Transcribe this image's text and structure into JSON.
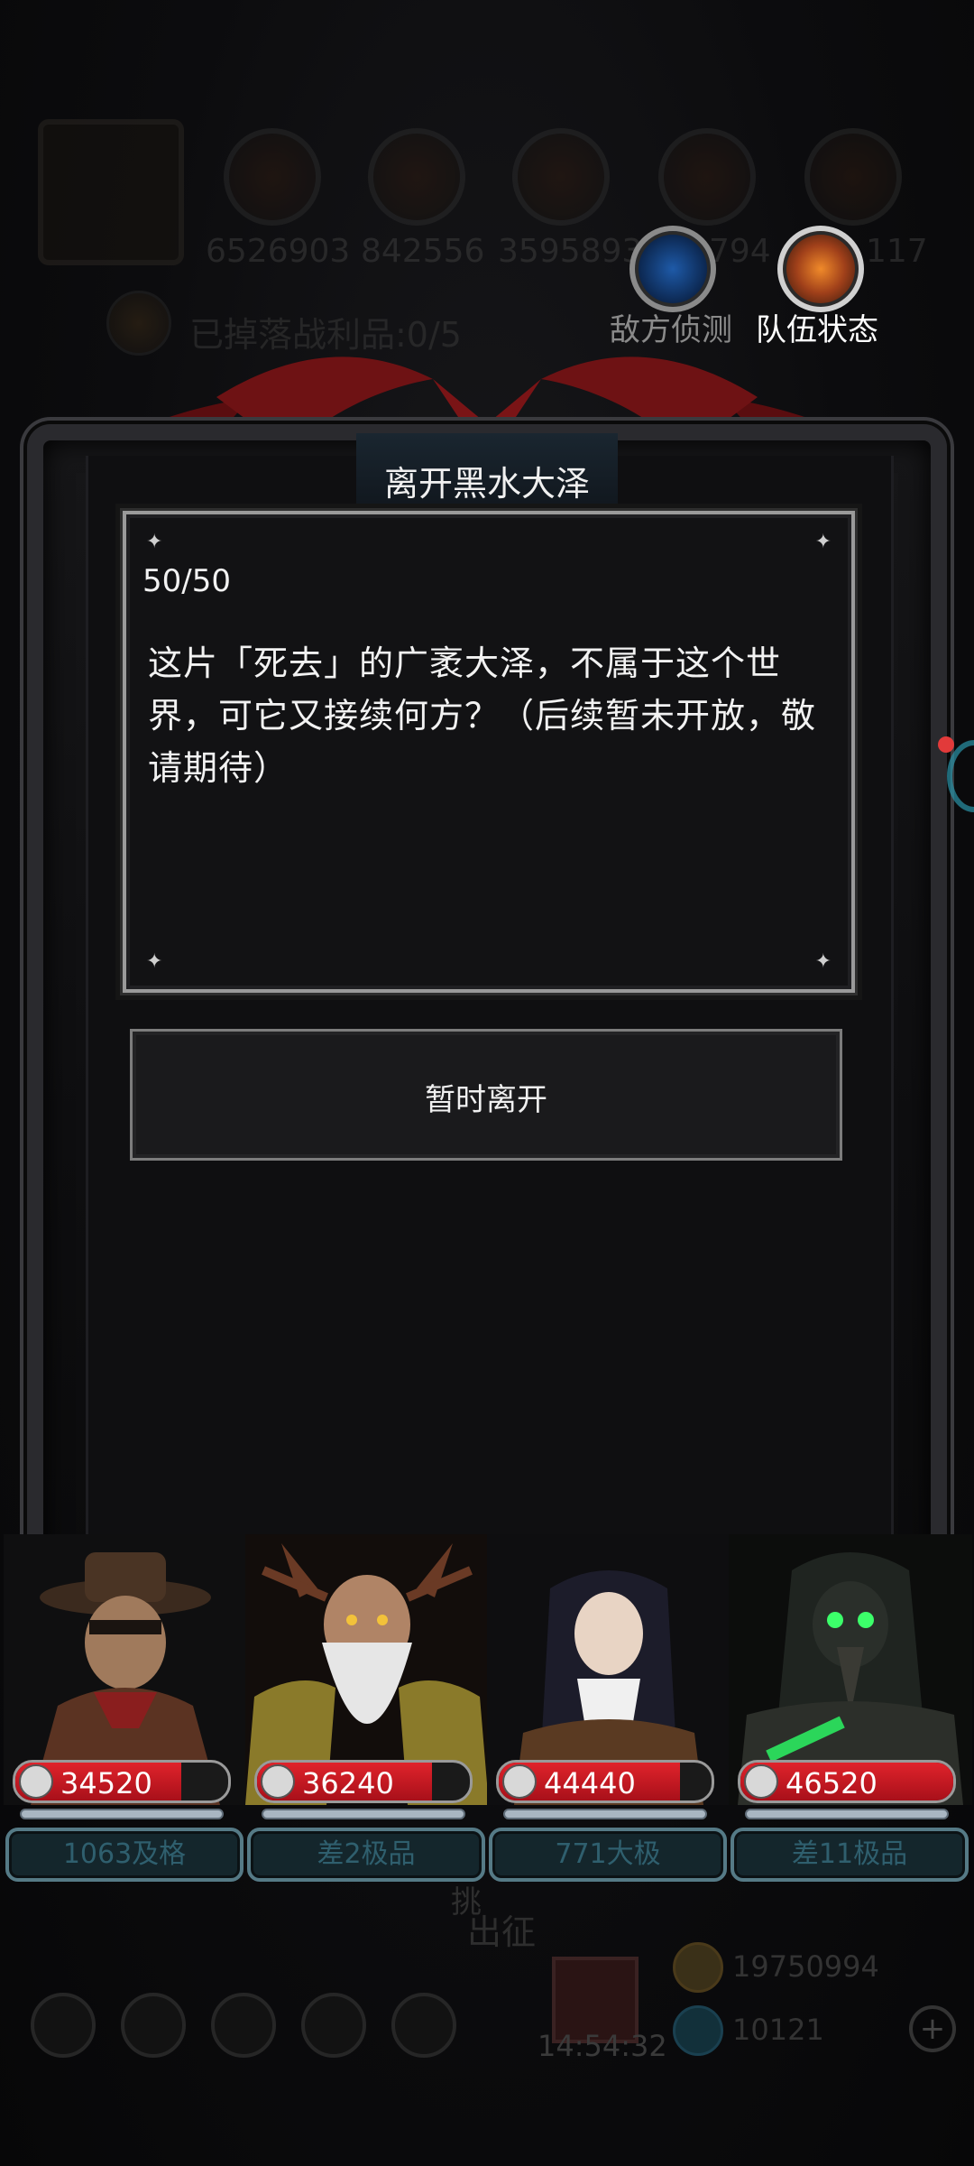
{
  "hud": {
    "resources": [
      "6526903",
      "842556",
      "3595893",
      "794",
      "117"
    ],
    "loot_text": "已掉落战利品:0/5",
    "enemy_scan_label": "敌方侦测",
    "team_status_label": "队伍状态"
  },
  "dialog": {
    "title": "离开黑水大泽",
    "counter": "50/50",
    "body": "这片「死去」的广袤大泽，不属于这个世界，可它又接续何方？（后续暂未开放，敬请期待）",
    "leave_button": "暂时离开"
  },
  "heroes": [
    {
      "power": "34520",
      "fill": 0.78,
      "quality": "1063及格",
      "icon": "cowboy-hero-portrait"
    },
    {
      "power": "36240",
      "fill": 0.82,
      "quality": "差2极品",
      "icon": "druid-elder-hero-portrait"
    },
    {
      "power": "44440",
      "fill": 0.85,
      "quality": "771大极",
      "icon": "nun-hero-portrait"
    },
    {
      "power": "46520",
      "fill": 1.0,
      "quality": "差11极品",
      "icon": "plague-doctor-hero-portrait"
    }
  ],
  "bottom": {
    "go_label": "出征",
    "challenge_label": "挑",
    "timer": "14:54:32",
    "gold": "19750994",
    "gems": "10121"
  },
  "colors": {
    "power_red": "#c8141e",
    "quality_teal": "#557a86",
    "frame_gray": "#9a9a9a"
  }
}
